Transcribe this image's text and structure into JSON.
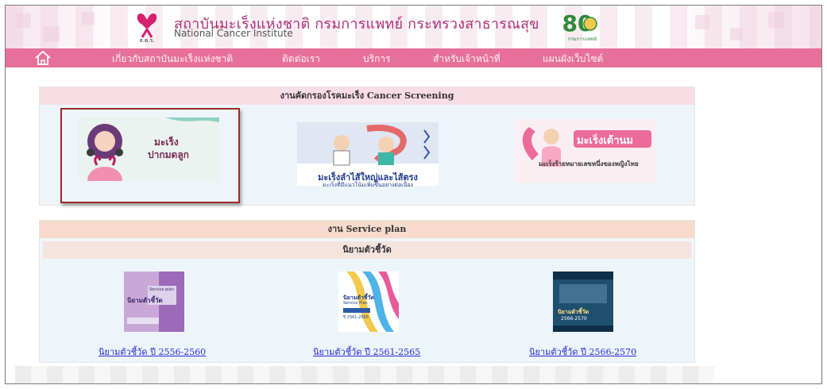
{
  "header": {
    "logo_text": "ส.ต.ร.",
    "title": "สถาบันมะเร็งแห่งชาติ กรมการแพทย์ กระทรวงสาธารณสุข",
    "subtitle": "National Cancer Institute",
    "anniversary_text": "80",
    "anniversary_caption": "กรมการแพทย์"
  },
  "nav": {
    "home_icon": "home-icon",
    "items": [
      "เกี่ยวกับสถาบันมะเร็งแห่งชาติ",
      "ติดต่อเรา",
      "บริการ",
      "สำหรับเจ้าหน้าที่",
      "แผนผังเว็บไซต์"
    ]
  },
  "screening": {
    "heading": "งานคัดกรองโรคมะเร็ง Cancer Screening",
    "cards": [
      {
        "title_line1": "มะเร็ง",
        "title_line2": "ปากมดลูก",
        "selected": true
      },
      {
        "title": "มะเร็งลำไส้ใหญ่และไส้ตรง",
        "subtitle": "มะเร็งที่มีแนวโน้มเพิ่มขึ้นอย่างต่อเนื่อง"
      },
      {
        "title": "มะเร็งเต้านม",
        "subtitle": "มะเร็งร้ายหมายเลขหนึ่งของหญิงไทย"
      }
    ]
  },
  "service_plan": {
    "heading": "งาน Service plan",
    "subheading": "นิยามตัวชี้วัด",
    "items": [
      {
        "cover_title": "นิยามตัวชี้วัด",
        "cover_subtitle": "Service plan",
        "link": "นิยามตัวชี้วัด ปี 2556-2560"
      },
      {
        "cover_title": "นิยามตัวชี้วัด",
        "cover_subtitle": "Service Plan",
        "cover_years": "ปี 2561-2565",
        "link": "นิยามตัวชี้วัด ปี 2561-2565"
      },
      {
        "cover_title": "นิยามตัวชี้วัด",
        "cover_years": "2566-2570",
        "link": "นิยามตัวชี้วัด ปี 2566-2570"
      }
    ]
  },
  "colors": {
    "nav": "#e7709a",
    "title_magenta": "#b0307a",
    "link_blue": "#2a2ad8",
    "highlight_border": "#9c2a2a"
  }
}
